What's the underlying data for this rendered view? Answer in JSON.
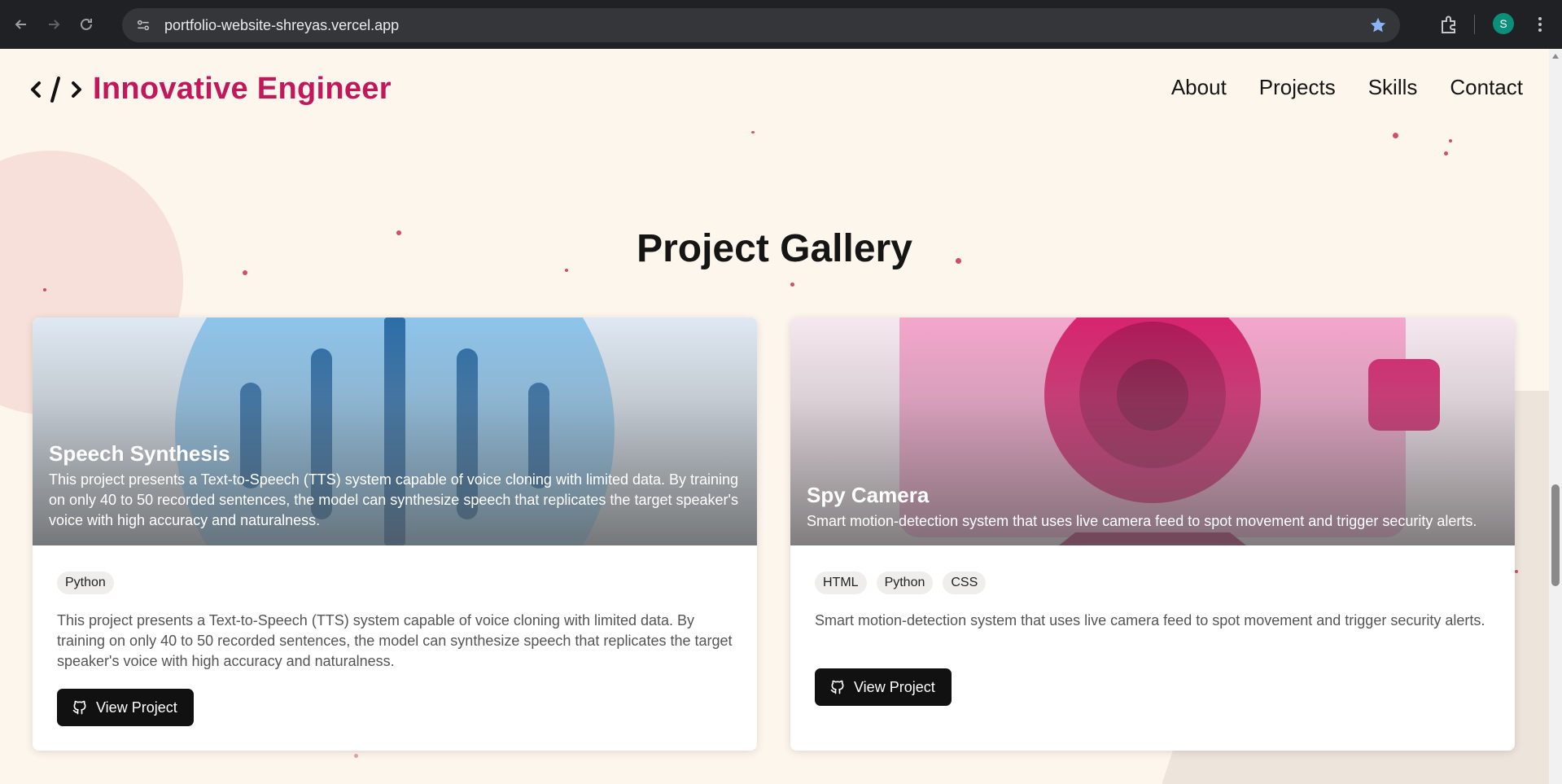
{
  "browser": {
    "url": "portfolio-website-shreyas.vercel.app",
    "avatar_letter": "S",
    "icons": [
      "back-arrow-icon",
      "forward-arrow-icon",
      "reload-icon",
      "site-info-icon",
      "bookmark-star-icon",
      "extensions-icon",
      "menu-icon"
    ]
  },
  "header": {
    "logo_symbol": "< / >",
    "brand": "Innovative Engineer",
    "nav": [
      "About",
      "Projects",
      "Skills",
      "Contact"
    ]
  },
  "gallery": {
    "title": "Project Gallery",
    "projects": [
      {
        "title": "Speech Synthesis",
        "overlay_description": "This project presents a Text-to-Speech (TTS) system capable of voice cloning with limited data. By training on only 40 to 50 recorded sentences, the model can synthesize speech that replicates the target speaker's voice with high accuracy and naturalness.",
        "tags": [
          "Python"
        ],
        "description": "This project presents a Text-to-Speech (TTS) system capable of voice cloning with limited data. By training on only 40 to 50 recorded sentences, the model can synthesize speech that replicates the target speaker's voice with high accuracy and naturalness.",
        "button": "View Project"
      },
      {
        "title": "Spy Camera",
        "overlay_description": "Smart motion-detection system that uses live camera feed to spot movement and trigger security alerts.",
        "tags": [
          "HTML",
          "Python",
          "CSS"
        ],
        "description": "Smart motion-detection system that uses live camera feed to spot movement and trigger security alerts.",
        "button": "View Project"
      }
    ]
  },
  "colors": {
    "brand": "#c2185b",
    "page_bg": "#fdf6ec",
    "button_bg": "#111111"
  }
}
